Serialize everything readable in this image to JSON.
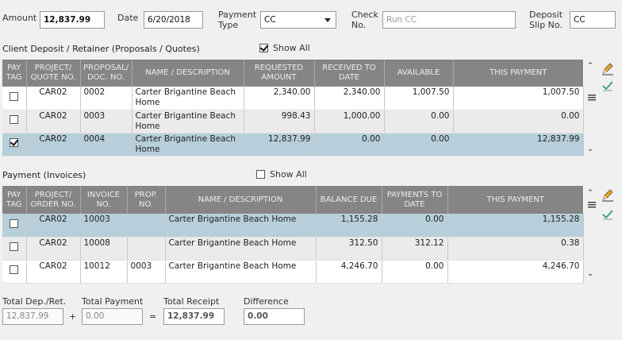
{
  "header": {
    "amount_label": "Amount",
    "amount_value": "12,837.99",
    "date_label": "Date",
    "date_value": "6/20/2018",
    "payment_type_label_1": "Payment",
    "payment_type_label_2": "Type",
    "payment_type_value": "CC",
    "check_no_label_1": "Check",
    "check_no_label_2": "No.",
    "check_no_placeholder": "Run CC",
    "deposit_slip_label_1": "Deposit",
    "deposit_slip_label_2": "Slip No.",
    "deposit_slip_value": "CC"
  },
  "deposit_section": {
    "title": "Client Deposit / Retainer (Proposals / Quotes)",
    "show_all_label": "Show All",
    "show_all_checked": true,
    "columns": [
      "PAY TAG",
      "PROJECT/ QUOTE NO.",
      "PROPOSAL/ DOC. NO.",
      "NAME / DESCRIPTION",
      "REQUESTED AMOUNT",
      "RECEIVED TO DATE",
      "AVAILABLE",
      "THIS PAYMENT"
    ],
    "rows": [
      {
        "checked": false,
        "project": "CAR02",
        "doc": "0002",
        "name": "Carter Brigantine Beach Home",
        "requested": "2,340.00",
        "received": "2,340.00",
        "available": "1,007.50",
        "payment": "1,007.50"
      },
      {
        "checked": false,
        "project": "CAR02",
        "doc": "0003",
        "name": "Carter Brigantine Beach Home",
        "requested": "998.43",
        "received": "1,000.00",
        "available": "0.00",
        "payment": "0.00"
      },
      {
        "checked": true,
        "project": "CAR02",
        "doc": "0004",
        "name": "Carter Brigantine Beach Home",
        "requested": "12,837.99",
        "received": "0.00",
        "available": "0.00",
        "payment": "12,837.99"
      }
    ]
  },
  "invoice_section": {
    "title": "Payment (Invoices)",
    "show_all_label": "Show All",
    "show_all_checked": false,
    "columns": [
      "PAY TAG",
      "PROJECT/ ORDER NO.",
      "INVOICE NO.",
      "PROP. NO.",
      "NAME / DESCRIPTION",
      "BALANCE DUE",
      "PAYMENTS TO DATE",
      "THIS PAYMENT"
    ],
    "rows": [
      {
        "checked": false,
        "project": "CAR02",
        "invoice": "10003",
        "prop": "",
        "name": "Carter Brigantine Beach Home",
        "balance": "1,155.28",
        "paid": "0.00",
        "payment": "1,155.28"
      },
      {
        "checked": false,
        "project": "CAR02",
        "invoice": "10008",
        "prop": "",
        "name": "Carter Brigantine Beach Home",
        "balance": "312.50",
        "paid": "312.12",
        "payment": "0.38"
      },
      {
        "checked": false,
        "project": "CAR02",
        "invoice": "10012",
        "prop": "0003",
        "name": "Carter Brigantine Beach Home",
        "balance": "4,246.70",
        "paid": "0.00",
        "payment": "4,246.70"
      }
    ]
  },
  "totals": {
    "total_dep_label": "Total Dep./Ret.",
    "total_dep_value": "12,837.99",
    "plus_sign": "+",
    "total_payment_label": "Total Payment",
    "total_payment_value": "0.00",
    "equals_sign": "=",
    "total_receipt_label": "Total Receipt",
    "total_receipt_value": "12,837.99",
    "difference_label": "Difference",
    "difference_value": "0.00"
  },
  "icons": {
    "edit": "pencil-icon",
    "accept": "checkmark-icon",
    "details": "list-icon",
    "scroll_up": "scroll-up-icon",
    "scroll_down": "scroll-down-icon"
  },
  "colors": {
    "header_bg": "#858585",
    "selected_row": "#b7cfdb",
    "alt_row": "#ebebeb"
  }
}
